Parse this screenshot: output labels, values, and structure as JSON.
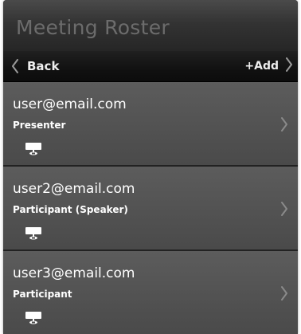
{
  "header": {
    "title": "Meeting Roster"
  },
  "nav": {
    "back_label": "Back",
    "add_label": "+Add"
  },
  "roster": [
    {
      "email": "user@email.com",
      "role": "Presenter"
    },
    {
      "email": "user2@email.com",
      "role": "Participant (Speaker)"
    },
    {
      "email": "user3@email.com",
      "role": "Participant"
    }
  ],
  "icons": {
    "back": "chevron-left-icon",
    "add": "chevron-right-icon",
    "row_disclosure": "chevron-right-icon",
    "role_indicator": "presentation-screen-icon"
  },
  "colors": {
    "title_text": "#6c6c6c",
    "nav_background": "#111111",
    "row_background": "#555555",
    "row_text": "#ffffff",
    "chevron": "#8a8a8a"
  }
}
